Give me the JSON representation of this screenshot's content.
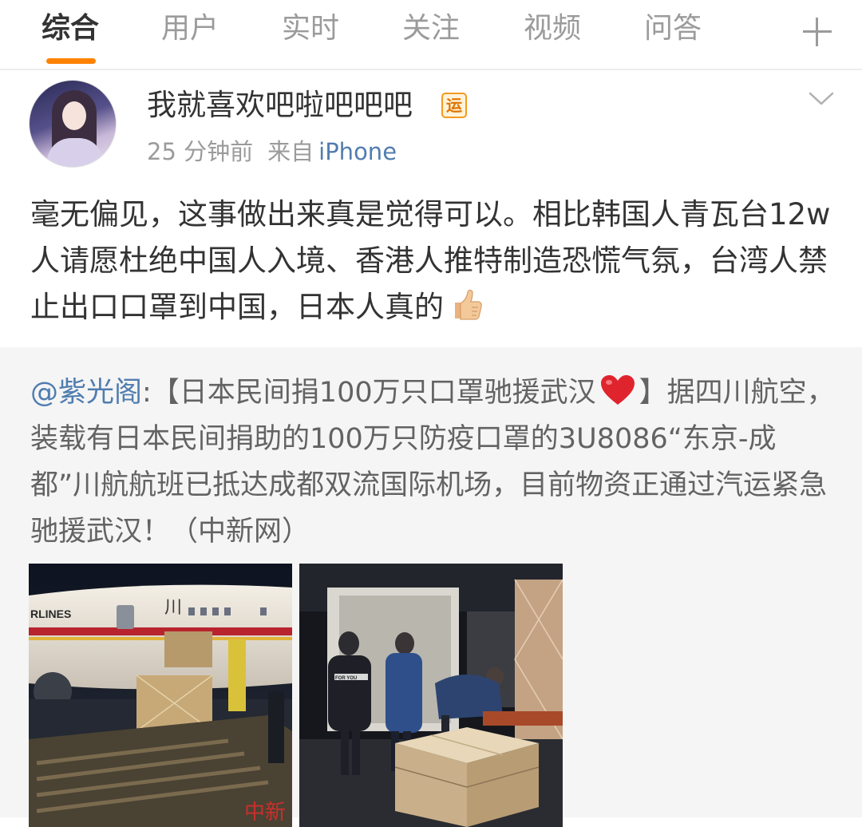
{
  "tabs": [
    {
      "label": "综合",
      "active": true
    },
    {
      "label": "用户",
      "active": false
    },
    {
      "label": "实时",
      "active": false
    },
    {
      "label": "关注",
      "active": false
    },
    {
      "label": "视频",
      "active": false
    },
    {
      "label": "问答",
      "active": false
    }
  ],
  "accent_color": "#ff8200",
  "link_color": "#507daf",
  "post": {
    "username": "我就喜欢吧啦吧吧吧",
    "badge": "运",
    "time": "25 分钟前",
    "source_label": "来自",
    "device": "iPhone",
    "text": "毫无偏见，这事做出来真是觉得可以。相比韩国人青瓦台12w人请愿杜绝中国人入境、香港人推特制造恐慌气氛，台湾人禁止出口口罩到中国，日本人真的"
  },
  "repost": {
    "mention": "@紫光阁",
    "text_before_heart": ":【日本民间捐100万只口罩驰援武汉",
    "text_after_heart": "】据四川航空，装载有日本民间捐助的100万只防疫口罩的3U8086“东京-成都”川航航班已抵达成都双流国际机场，目前物资正通过汽运紧急驰援武汉！（中新网）"
  },
  "images": {
    "photo1_alt": "airplane-cargo-loading-photo",
    "photo1_watermark": "中新",
    "photo1_airline_text": "RLINES",
    "photo1_livery_text": "川",
    "photo2_alt": "workers-unloading-boxes-photo",
    "photo2_jacket_text": "FOR YOU"
  },
  "icons": {
    "add_tab": "plus-icon",
    "menu": "chevron-down-icon",
    "thumbs_up": "thumbs-up-emoji",
    "heart": "red-heart-emoji"
  }
}
